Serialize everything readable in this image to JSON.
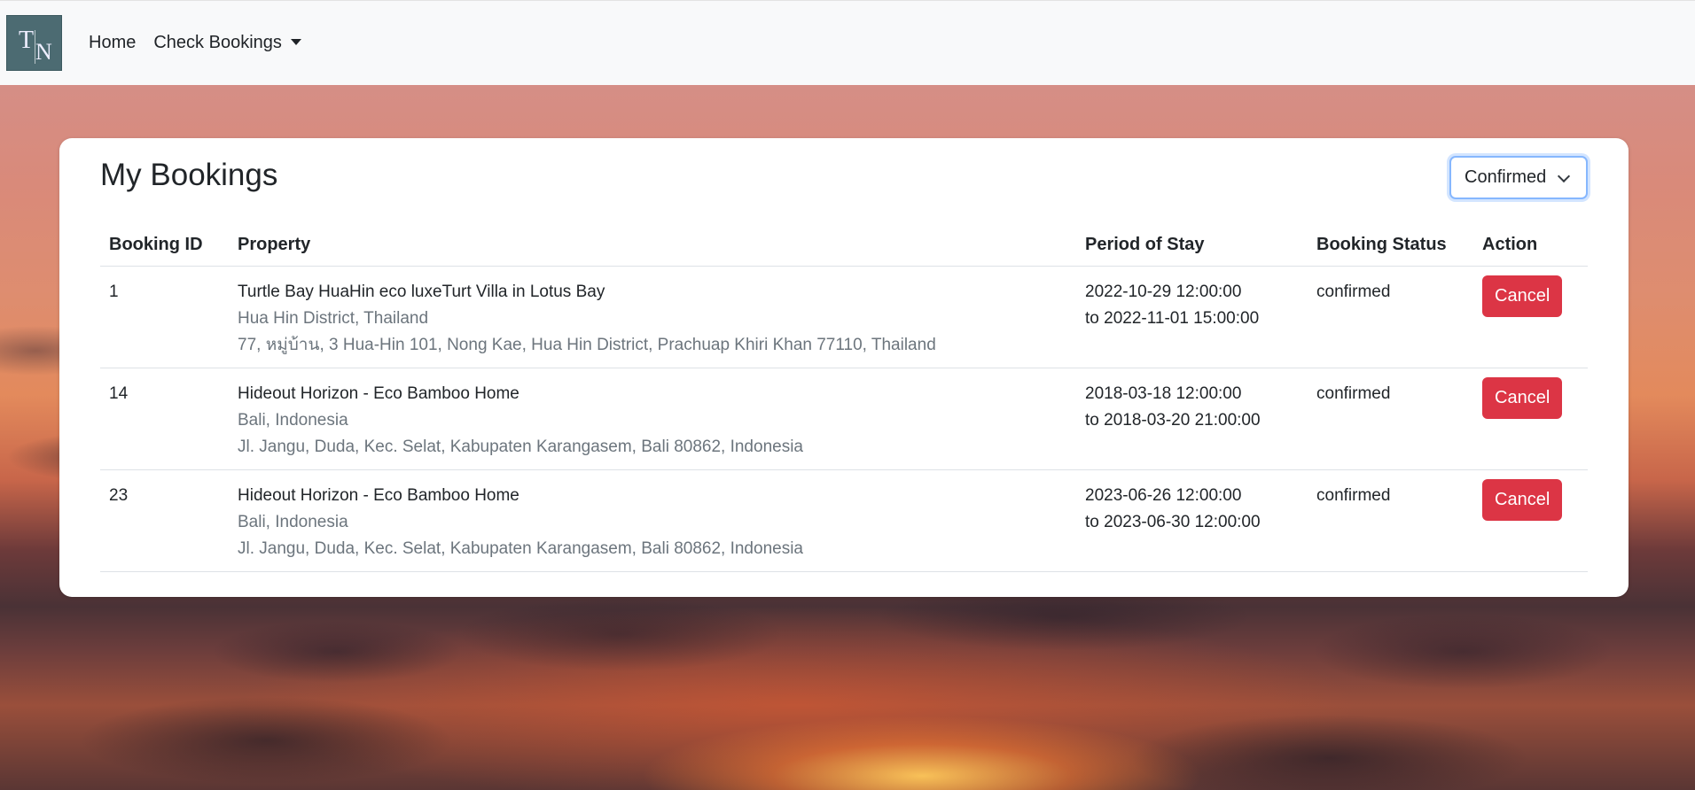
{
  "nav": {
    "logo_t": "T",
    "logo_n": "N",
    "home_label": "Home",
    "check_bookings_label": "Check Bookings"
  },
  "main": {
    "title": "My Bookings",
    "status_filter": "Confirmed",
    "columns": [
      "Booking ID",
      "Property",
      "Period of Stay",
      "Booking Status",
      "Action"
    ],
    "bookings": [
      {
        "id": "1",
        "property_name": "Turtle Bay HuaHin eco luxeTurt Villa in Lotus Bay",
        "location": "Hua Hin District, Thailand",
        "address": "77, หมู่บ้าน, 3 Hua-Hin 101, Nong Kae, Hua Hin District, Prachuap Khiri Khan 77110, Thailand",
        "period_start": "2022-10-29 12:00:00",
        "period_end": "to 2022-11-01 15:00:00",
        "status": "confirmed",
        "action_label": "Cancel"
      },
      {
        "id": "14",
        "property_name": "Hideout Horizon - Eco Bamboo Home",
        "location": "Bali, Indonesia",
        "address": "Jl. Jangu, Duda, Kec. Selat, Kabupaten Karangasem, Bali 80862, Indonesia",
        "period_start": "2018-03-18 12:00:00",
        "period_end": "to 2018-03-20 21:00:00",
        "status": "confirmed",
        "action_label": "Cancel"
      },
      {
        "id": "23",
        "property_name": "Hideout Horizon - Eco Bamboo Home",
        "location": "Bali, Indonesia",
        "address": "Jl. Jangu, Duda, Kec. Selat, Kabupaten Karangasem, Bali 80862, Indonesia",
        "period_start": "2023-06-26 12:00:00",
        "period_end": "to 2023-06-30 12:00:00",
        "status": "confirmed",
        "action_label": "Cancel"
      }
    ]
  },
  "colors": {
    "cancel_button": "#dc3545",
    "navbar_bg": "#f8f9fa",
    "logo_bg": "#4c6b72"
  }
}
